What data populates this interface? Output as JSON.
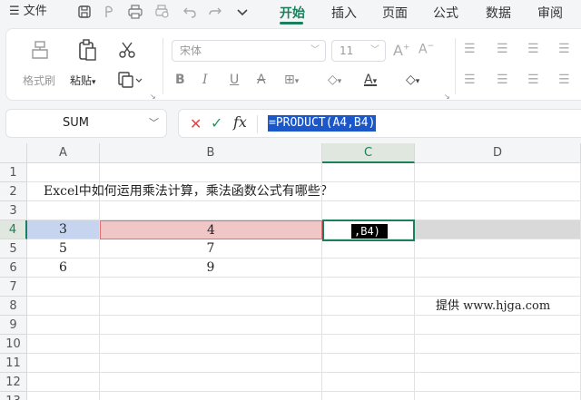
{
  "menu": {
    "file_label": "文件",
    "tabs": [
      {
        "label": "开始",
        "active": true
      },
      {
        "label": "插入",
        "active": false
      },
      {
        "label": "页面",
        "active": false
      },
      {
        "label": "公式",
        "active": false
      },
      {
        "label": "数据",
        "active": false
      },
      {
        "label": "审阅",
        "active": false
      }
    ]
  },
  "ribbon": {
    "format_painter_label": "格式刷",
    "paste_label": "粘贴",
    "font_name": "宋体",
    "font_size": "11"
  },
  "formula_bar": {
    "name_box": "SUM",
    "fx_label": "fx",
    "formula": "=PRODUCT(A4,B4)"
  },
  "grid": {
    "columns": [
      "A",
      "B",
      "C",
      "D"
    ],
    "rows": [
      "1",
      "2",
      "3",
      "4",
      "5",
      "6",
      "7",
      "8",
      "9",
      "10",
      "11",
      "12",
      "13"
    ],
    "title_text": "Excel中如何运用乘法计算，乘法函数公式有哪些？",
    "editing_text": ",B4)",
    "values": [
      {
        "row": "4",
        "a": "3",
        "b": "4"
      },
      {
        "row": "5",
        "a": "5",
        "b": "7"
      },
      {
        "row": "6",
        "a": "6",
        "b": "9"
      }
    ],
    "watermark": "提供 www.hjga.com"
  },
  "colors": {
    "accent": "#1a7f5a",
    "ref_a": "#c6d4f0",
    "ref_b": "#f0c6c6"
  }
}
